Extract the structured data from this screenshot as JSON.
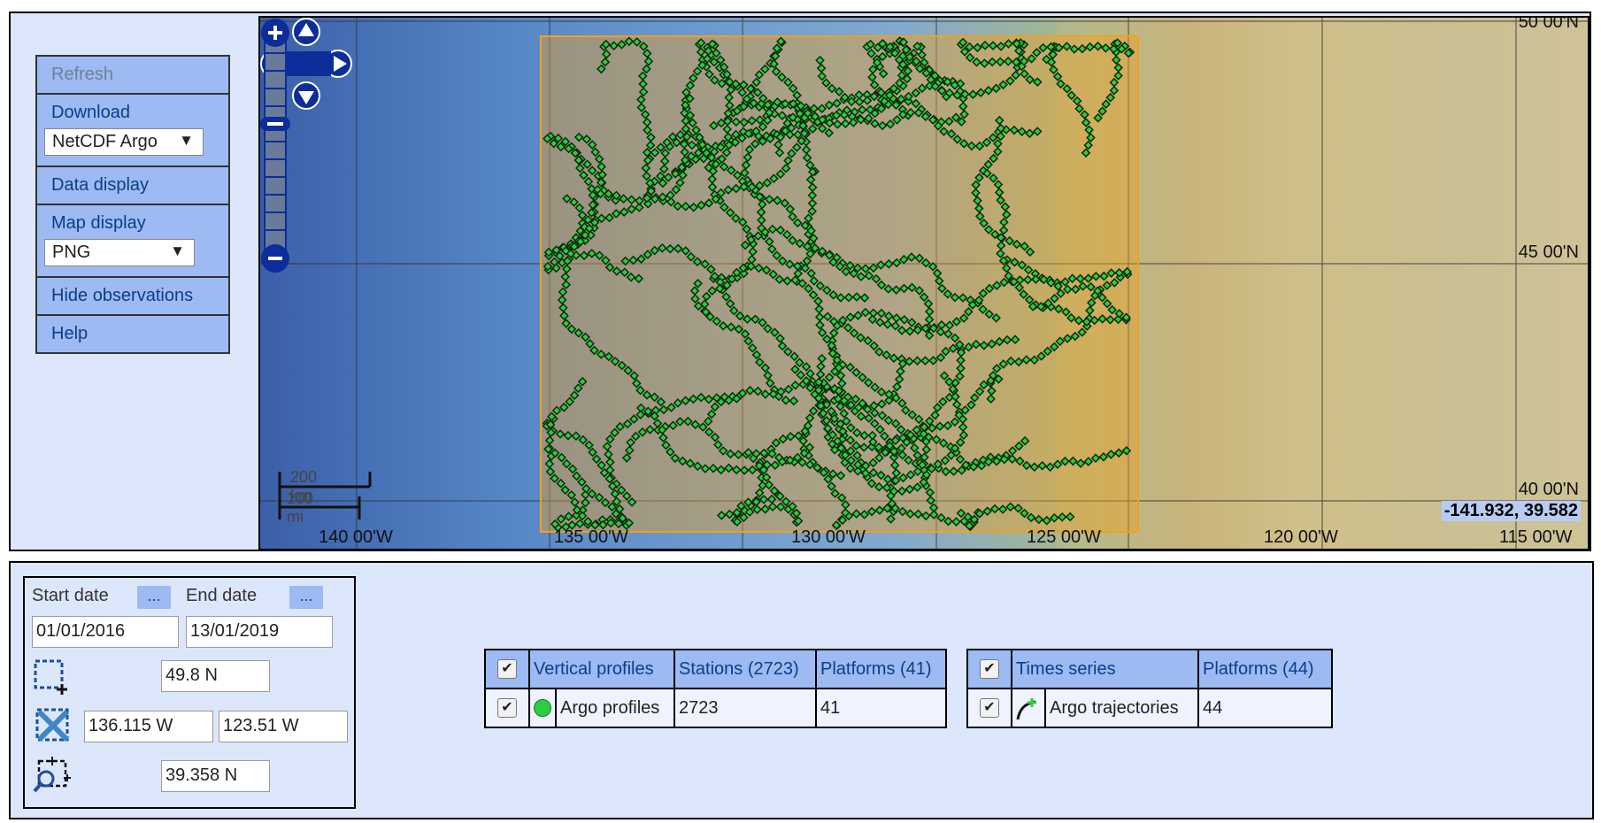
{
  "menu": {
    "refresh_label": "Refresh",
    "download_label": "Download",
    "download_format": "NetCDF Argo",
    "data_display_label": "Data display",
    "map_display_label": "Map display",
    "map_format": "PNG",
    "hide_observations_label": "Hide observations",
    "help_label": "Help"
  },
  "map": {
    "lat_labels": [
      "50 00'N",
      "45 00'N",
      "40 00'N"
    ],
    "lon_labels": [
      "140 00'W",
      "135 00'W",
      "130 00'W",
      "125 00'W",
      "120 00'W",
      "115 00'W"
    ],
    "scale_km": "200 km",
    "scale_mi": "100 mi",
    "cursor_coords": "-141.932, 39.582",
    "selection_color": "#f0a020",
    "marker_color": "#2ecc40"
  },
  "filter": {
    "start_date_label": "Start date",
    "end_date_label": "End date",
    "dots_label": "...",
    "start_date": "01/01/2016",
    "end_date": "13/01/2019",
    "north": "49.8 N",
    "west": "136.115 W",
    "east": "123.51 W",
    "south": "39.358 N",
    "icons": [
      "select-box-icon",
      "clear-box-icon",
      "zoom-box-icon"
    ]
  },
  "profiles_table": {
    "header": {
      "title": "Vertical profiles",
      "stations": "Stations (2723)",
      "platforms": "Platforms (41)"
    },
    "row": {
      "name": "Argo profiles",
      "stations": "2723",
      "platforms": "41"
    }
  },
  "series_table": {
    "header": {
      "title": "Times series",
      "platforms": "Platforms (44)"
    },
    "row": {
      "name": "Argo trajectories",
      "platforms": "44"
    }
  }
}
